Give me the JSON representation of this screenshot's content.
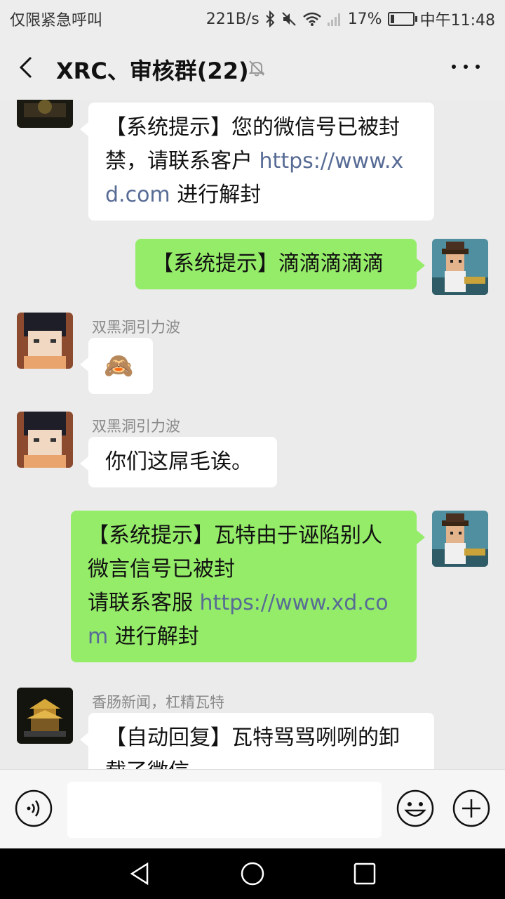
{
  "status_bar": {
    "left_text": "仅限紧急呼叫",
    "net_speed": "221B/s",
    "battery_percent": "17%",
    "battery_level": 0.17,
    "time": "中午11:48",
    "icons": [
      "bluetooth-icon",
      "mute-icon",
      "wifi-icon",
      "signal-icon",
      "battery-icon"
    ]
  },
  "header": {
    "title": "XRC、审核群(22)",
    "back_icon": "chevron-left-icon",
    "mute_icon": "bell-off-icon",
    "more_icon": "more-icon"
  },
  "messages": [
    {
      "direction": "in",
      "sender": "",
      "text": "【系统提示】您的微信号已被封禁，请联系客户 ",
      "link": "https://www.xd.com",
      "suffix": " 进行解封"
    },
    {
      "direction": "out",
      "text": "【系统提示】滴滴滴滴滴"
    },
    {
      "direction": "in",
      "sender": "双黑洞引力波",
      "emoji": "🙈"
    },
    {
      "direction": "in",
      "sender": "双黑洞引力波",
      "text": "你们这屌毛诶。"
    },
    {
      "direction": "out",
      "line1": "【系统提示】瓦特由于诬陷别人",
      "line2": "微言信号已被封",
      "line3_prefix": "请联系客服 ",
      "link": "https://www.xd.com",
      "suffix": " 进行解封"
    },
    {
      "direction": "in",
      "sender": "香肠新闻，杠精瓦特",
      "text": "【自动回复】瓦特骂骂咧咧的卸载了微信"
    }
  ],
  "input_bar": {
    "placeholder": "",
    "voice_icon": "voice-icon",
    "emoji_icon": "smiley-icon",
    "plus_icon": "plus-icon"
  },
  "colors": {
    "background": "#ebebeb",
    "out_bubble": "#95ec69",
    "in_bubble": "#ffffff",
    "link": "#576b95"
  }
}
